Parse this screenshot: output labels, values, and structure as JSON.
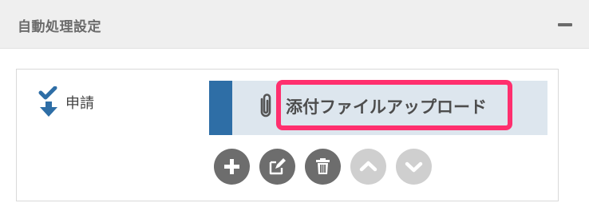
{
  "panel": {
    "title": "自動処理設定",
    "collapse_icon": "minus-icon"
  },
  "step": {
    "label": "申請",
    "icon": "arrow-down-check-icon"
  },
  "action": {
    "label": "添付ファイルアップロード",
    "icon": "paperclip-icon",
    "highlighted": true,
    "highlight_color": "#ff2f6e",
    "accent_color": "#2e6ea6"
  },
  "controls": [
    {
      "name": "add",
      "icon": "plus-icon",
      "enabled": true
    },
    {
      "name": "edit",
      "icon": "edit-icon",
      "enabled": true
    },
    {
      "name": "delete",
      "icon": "trash-icon",
      "enabled": true
    },
    {
      "name": "move-up",
      "icon": "chevron-up-icon",
      "enabled": false
    },
    {
      "name": "move-down",
      "icon": "chevron-down-icon",
      "enabled": false
    }
  ]
}
